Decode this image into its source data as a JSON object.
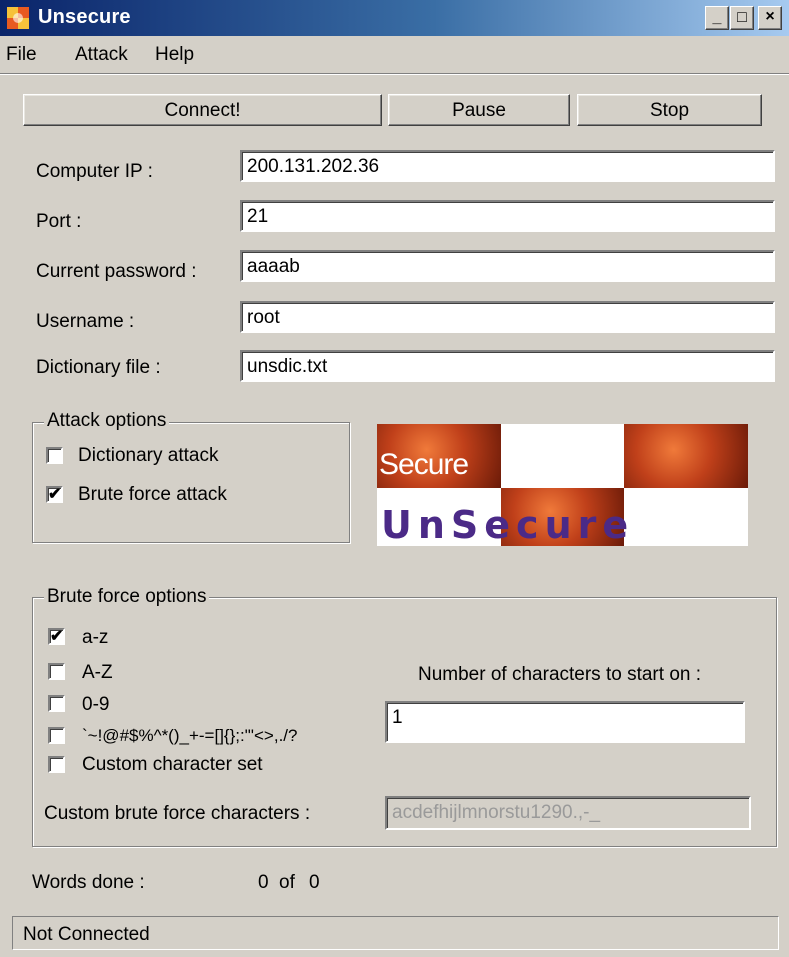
{
  "window": {
    "title": "Unsecure",
    "controls": {
      "minimize": "_",
      "maximize": "□",
      "close": "×"
    },
    "colors": {
      "title_start": "#0a246a",
      "title_end": "#a6caf0",
      "face": "#d4d0c8",
      "logo_text": "#4b2a87",
      "logo_red": "#c0401a"
    }
  },
  "menu": {
    "items": [
      "File",
      "Attack",
      "Help"
    ]
  },
  "toolbar": {
    "connect": "Connect!",
    "pause": "Pause",
    "stop": "Stop"
  },
  "form": {
    "computer_ip": {
      "label": "Computer IP :",
      "value": "200.131.202.36"
    },
    "port": {
      "label": "Port :",
      "value": "21"
    },
    "current_password": {
      "label": "Current password :",
      "value": "aaaab"
    },
    "username": {
      "label": "Username :",
      "value": "root"
    },
    "dictionary_file": {
      "label": "Dictionary file :",
      "value": "unsdic.txt"
    }
  },
  "attack_options": {
    "title": "Attack options",
    "dictionary": {
      "label": "Dictionary attack",
      "checked": false
    },
    "brute_force": {
      "label": "Brute force attack",
      "checked": true
    }
  },
  "logo": {
    "secure": "Secure",
    "unsecure": "UnSecure"
  },
  "brute_force_options": {
    "title": "Brute force options",
    "lowercase": {
      "label": "a-z",
      "checked": true
    },
    "uppercase": {
      "label": "A-Z",
      "checked": false
    },
    "digits": {
      "label": "0-9",
      "checked": false
    },
    "symbols": {
      "label": "`~!@#$%^*()_+-=[]{};:\"'<>,./?",
      "checked": false
    },
    "custom": {
      "label": "Custom character set",
      "checked": false
    },
    "start_chars": {
      "label": "Number of characters to start on :",
      "value": "1"
    },
    "custom_chars": {
      "label": "Custom brute force characters :",
      "value": "acdefhijlmnorstu1290.,-_"
    }
  },
  "progress": {
    "label": "Words done :",
    "done": "0",
    "of": "of",
    "total": "0"
  },
  "status": {
    "text": "Not Connected"
  },
  "check_mark": "✔"
}
